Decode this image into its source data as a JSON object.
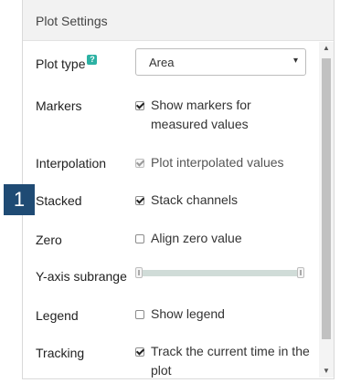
{
  "panel": {
    "title": "Plot Settings"
  },
  "badge": "1",
  "plot_type": {
    "label": "Plot type",
    "help": "?",
    "value": "Area",
    "arrow": "▾"
  },
  "markers": {
    "label": "Markers",
    "option": "Show markers for measured values",
    "checked": true
  },
  "interpolation": {
    "label": "Interpolation",
    "option": "Plot interpolated values",
    "checked": true,
    "disabled": true
  },
  "stacked": {
    "label": "Stacked",
    "option": "Stack channels",
    "checked": true
  },
  "zero": {
    "label": "Zero",
    "option": "Align zero value",
    "checked": false
  },
  "subrange": {
    "label": "Y-axis subrange",
    "min": 0,
    "max": 1
  },
  "legend": {
    "label": "Legend",
    "option": "Show legend",
    "checked": false
  },
  "tracking": {
    "label": "Tracking",
    "option": "Track the current time in the plot",
    "checked": true
  },
  "scroll": {
    "up": "▲",
    "down": "▼"
  }
}
